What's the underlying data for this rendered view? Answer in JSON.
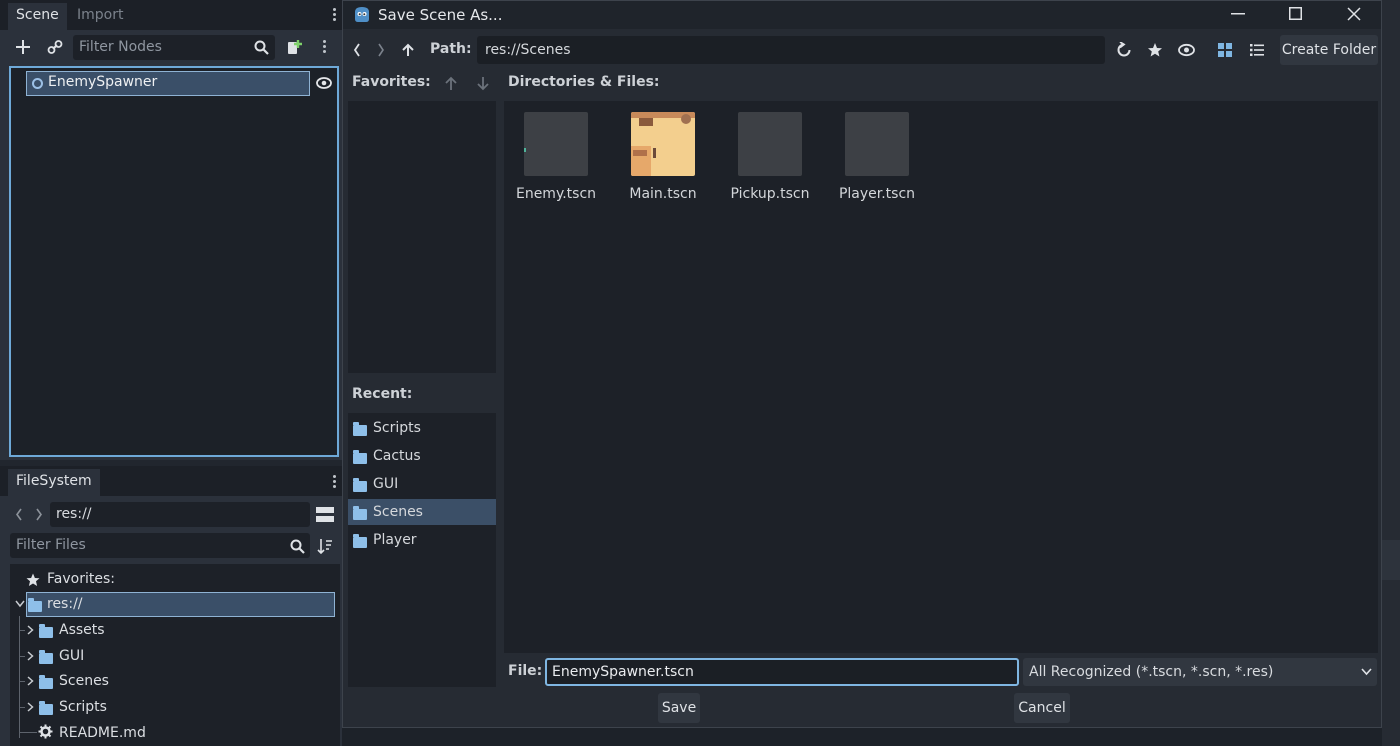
{
  "scene_dock": {
    "tabs": [
      {
        "label": "Scene",
        "active": true
      },
      {
        "label": "Import",
        "active": false
      }
    ],
    "filter_placeholder": "Filter Nodes",
    "root_node": {
      "label": "EnemySpawner"
    }
  },
  "filesystem_dock": {
    "tab_label": "FileSystem",
    "path": "res://",
    "filter_placeholder": "Filter Files",
    "favorites_label": "Favorites:",
    "tree": [
      {
        "label": "res://",
        "type": "folder",
        "selected": true
      },
      {
        "label": "Assets",
        "type": "folder"
      },
      {
        "label": "GUI",
        "type": "folder"
      },
      {
        "label": "Scenes",
        "type": "folder"
      },
      {
        "label": "Scripts",
        "type": "folder"
      },
      {
        "label": "README.md",
        "type": "file"
      }
    ]
  },
  "dialog": {
    "title": "Save Scene As...",
    "path_label": "Path:",
    "path_value": "res://Scenes",
    "create_folder_label": "Create Folder",
    "favorites_label": "Favorites:",
    "directories_label": "Directories & Files:",
    "recent_label": "Recent:",
    "recent_items": [
      {
        "label": "Scripts",
        "selected": false
      },
      {
        "label": "Cactus",
        "selected": false
      },
      {
        "label": "GUI",
        "selected": false
      },
      {
        "label": "Scenes",
        "selected": true
      },
      {
        "label": "Player",
        "selected": false
      }
    ],
    "files": [
      {
        "label": "Enemy.tscn",
        "thumb": "blank"
      },
      {
        "label": "Main.tscn",
        "thumb": "preview"
      },
      {
        "label": "Pickup.tscn",
        "thumb": "blank"
      },
      {
        "label": "Player.tscn",
        "thumb": "blank"
      }
    ],
    "file_label": "File:",
    "file_value": "EnemySpawner.tscn",
    "filter_value": "All Recognized (*.tscn, *.scn, *.res)",
    "save_label": "Save",
    "cancel_label": "Cancel"
  },
  "colors": {
    "accent": "#6ea9d8",
    "selection": "#3b4f67",
    "folder": "#8ebfe9",
    "panel_dark": "#1d2128"
  }
}
